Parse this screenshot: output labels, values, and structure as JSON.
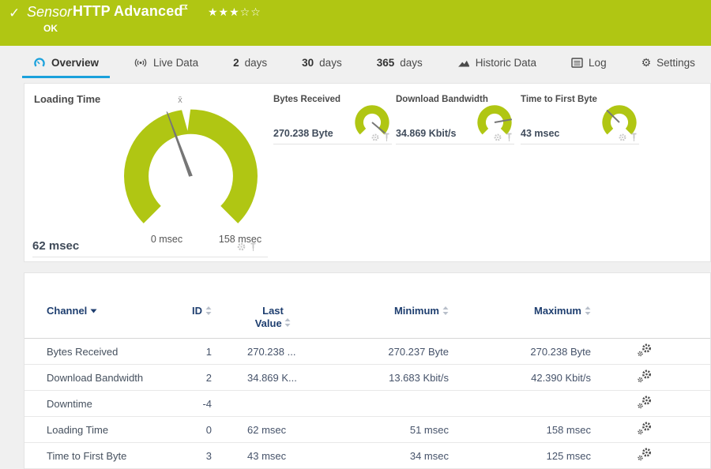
{
  "colors": {
    "status_green": "#b0c613",
    "accent_blue": "#1ba1dc",
    "table_header_blue": "#1e3e6f"
  },
  "header": {
    "kind": "Sensor",
    "title": "HTTP Advanced",
    "status": "OK",
    "stars": "★★★☆☆"
  },
  "tabs": {
    "overview": "Overview",
    "live": "Live Data",
    "d2_num": "2",
    "d2_label": "days",
    "d30_num": "30",
    "d30_label": "days",
    "d365_num": "365",
    "d365_label": "days",
    "historic": "Historic Data",
    "log": "Log",
    "settings": "Settings"
  },
  "gauges": {
    "primary": {
      "title": "Loading Time",
      "value": "62 msec",
      "scale_min": "0 msec",
      "scale_max": "158 msec",
      "mean_marker": "x̄"
    },
    "mini": [
      {
        "title": "Bytes Received",
        "value": "270.238 Byte"
      },
      {
        "title": "Download Bandwidth",
        "value": "34.869 Kbit/s"
      },
      {
        "title": "Time to First Byte",
        "value": "43 msec"
      }
    ]
  },
  "table": {
    "headers": {
      "channel": "Channel",
      "id": "ID",
      "last": "Last Value",
      "min": "Minimum",
      "max": "Maximum"
    },
    "rows": [
      {
        "channel": "Bytes Received",
        "id": "1",
        "last": "270.238 ...",
        "min": "270.237 Byte",
        "max": "270.238 Byte"
      },
      {
        "channel": "Download Bandwidth",
        "id": "2",
        "last": "34.869 K...",
        "min": "13.683 Kbit/s",
        "max": "42.390 Kbit/s"
      },
      {
        "channel": "Downtime",
        "id": "-4",
        "last": "",
        "min": "",
        "max": ""
      },
      {
        "channel": "Loading Time",
        "id": "0",
        "last": "62 msec",
        "min": "51 msec",
        "max": "158 msec"
      },
      {
        "channel": "Time to First Byte",
        "id": "3",
        "last": "43 msec",
        "min": "34 msec",
        "max": "125 msec"
      }
    ]
  }
}
